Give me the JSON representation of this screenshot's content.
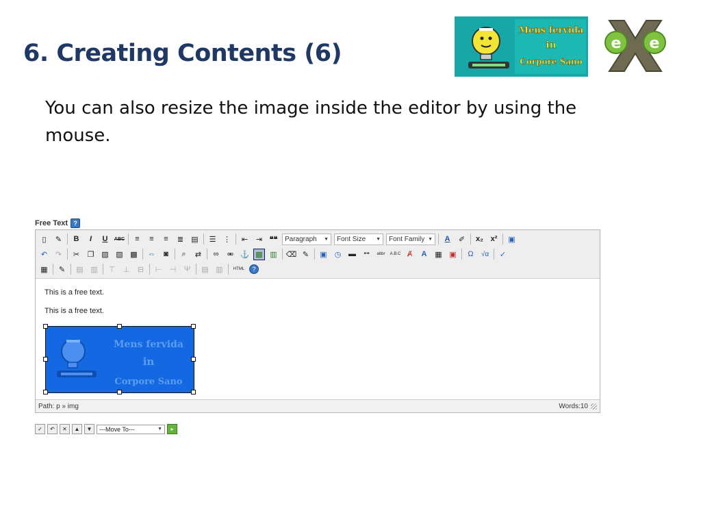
{
  "slide": {
    "title": "6. Creating Contents (6)",
    "body": "You can also resize the image inside the editor by using the mouse."
  },
  "logos": {
    "mens_lines": [
      "Mens fervida",
      "in",
      "Corpore Sano"
    ],
    "exe_letter": "e"
  },
  "editor": {
    "label": "Free Text",
    "help_icon": "?",
    "toolbar": {
      "format_select": "Paragraph",
      "font_size_select": "Font Size",
      "font_family_select": "Font Family",
      "bold": "B",
      "italic": "I",
      "underline": "U",
      "strike": "ABC",
      "font_color": "A",
      "subscript": "x₂",
      "superscript": "x²",
      "html": "HTML",
      "help": "?",
      "omega": "Ω",
      "sqrt": "√α",
      "quote": "❝❝"
    },
    "content": {
      "line1": "This is a free text.",
      "line2": "This is a free text."
    },
    "status": {
      "path": "Path: p » img",
      "words": "Words:10"
    },
    "actions": {
      "move_to": "---Move To---"
    }
  },
  "colors": {
    "title": "#1f3864",
    "image_fill": "#1469e2",
    "logo_bg": "#16a7a6"
  }
}
